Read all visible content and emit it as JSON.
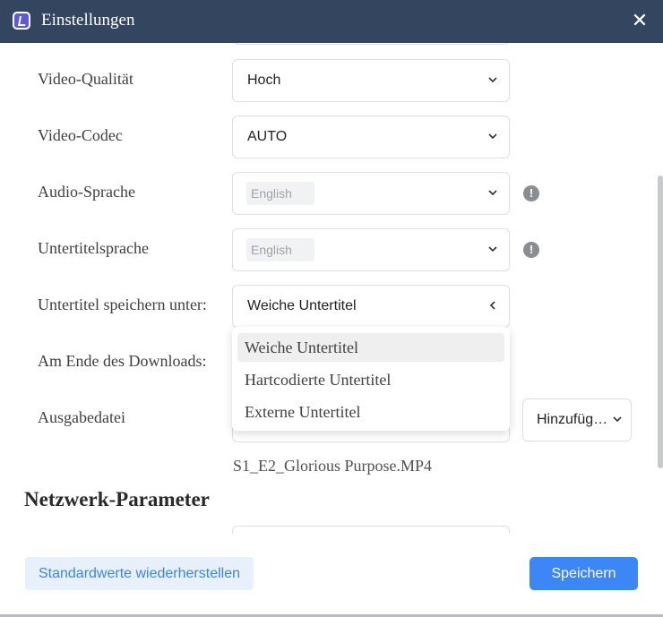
{
  "window": {
    "title": "Einstellungen",
    "app_icon": "app-logo-icon",
    "close_icon": "close-icon",
    "close_glyph": "✕",
    "title_bar_color": "#34465f"
  },
  "settings": {
    "video_quality": {
      "label": "Video-Qualität",
      "value": "Hoch"
    },
    "video_codec": {
      "label": "Video-Codec",
      "value": "AUTO"
    },
    "audio_language": {
      "label": "Audio-Sprache",
      "value": "English",
      "info_glyph": "!"
    },
    "subtitle_language": {
      "label": "Untertitelsprache",
      "value": "English",
      "info_glyph": "!"
    },
    "subtitle_save": {
      "label": "Untertitel speichern unter:",
      "value": "Weiche Untertitel",
      "options": [
        "Weiche Untertitel",
        "Hartcodierte Untertitel",
        "Externe Untertitel"
      ],
      "expanded": true
    },
    "on_download_end": {
      "label": "Am Ende des Downloads:"
    },
    "output_file": {
      "label": "Ausgabedatei",
      "add_button": "Hinzufüg…",
      "filename": "S1_E2_Glorious Purpose.MP4"
    }
  },
  "sections": {
    "network_title": "Netzwerk-Parameter"
  },
  "footer": {
    "reset_label": "Standardwerte wiederherstellen",
    "save_label": "Speichern",
    "accent_color": "#3d86f5"
  }
}
